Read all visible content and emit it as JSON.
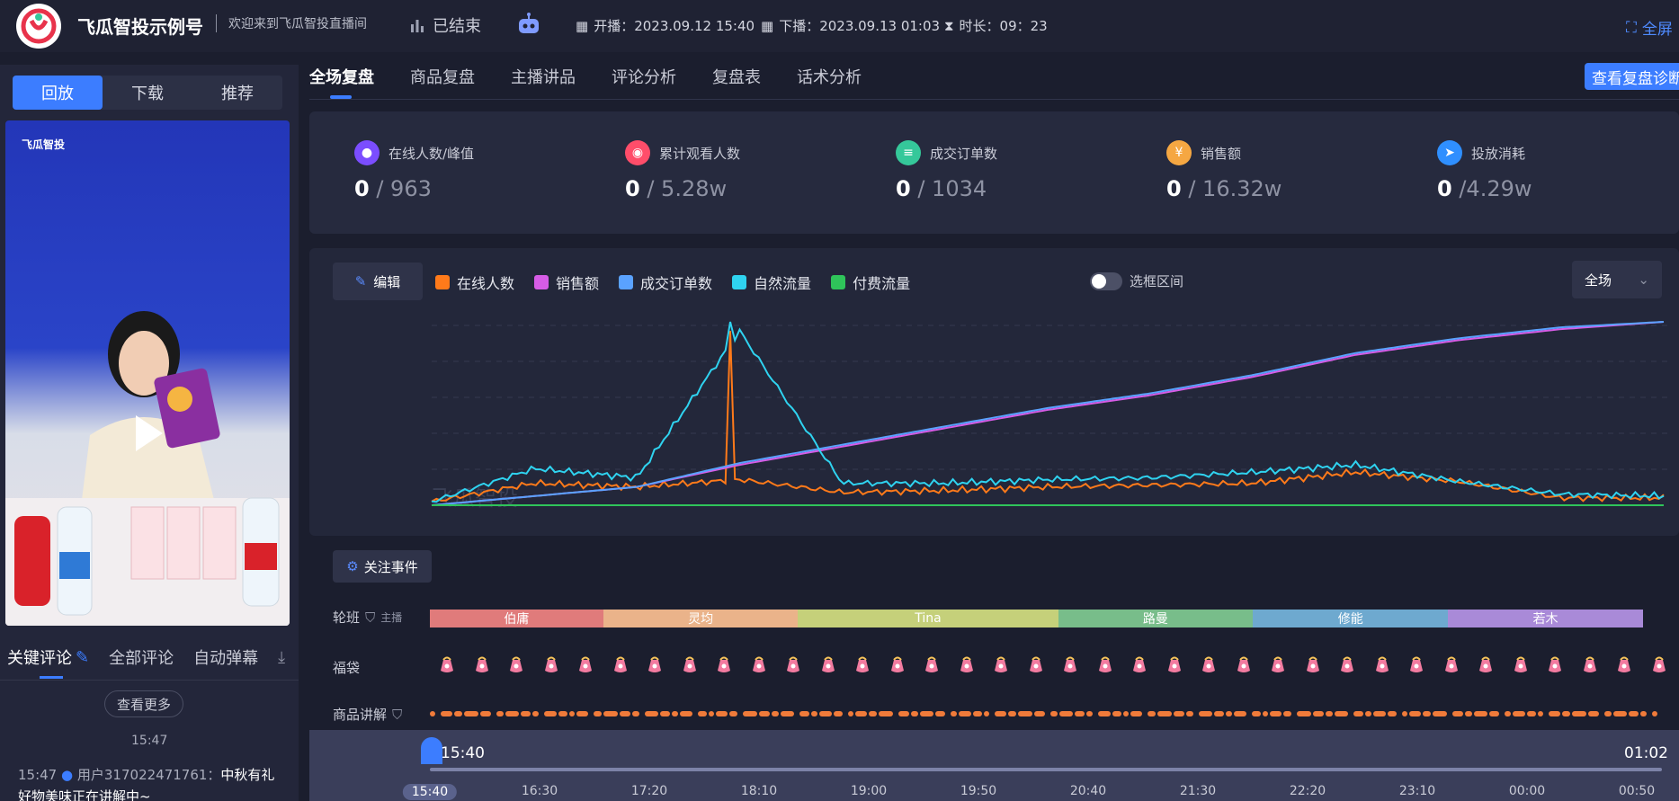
{
  "header": {
    "brand": "飞瓜智投示例号",
    "welcome": "欢迎来到飞瓜智投直播间",
    "status": "已结束",
    "start_label": "开播：2023.09.12 15:40",
    "end_label": "下播：2023.09.13 01:03",
    "duration_label": "时长：09：23",
    "fullscreen": "全屏"
  },
  "left": {
    "tabs": [
      "回放",
      "下载",
      "推荐"
    ],
    "video_logo": "飞瓜智投",
    "comment_tabs": [
      "关键评论",
      "全部评论",
      "自动弹幕"
    ],
    "more": "查看更多",
    "time": "15:47",
    "comment_time": "15:47",
    "comment_user": "用户317022471761：",
    "comment_text": "中秋有礼好物美味正在讲解中~"
  },
  "main_tabs": [
    "全场复盘",
    "商品复盘",
    "主播讲品",
    "评论分析",
    "复盘表",
    "话术分析"
  ],
  "diag_button": "查看复盘诊断",
  "stats": [
    {
      "label": "在线人数/峰值",
      "value": "0",
      "total": " / 963",
      "color": "#7b4dff",
      "icon": "user-icon"
    },
    {
      "label": "累计观看人数",
      "value": "0",
      "total": " / 5.28w",
      "color": "#ff4d6a",
      "icon": "eye-icon"
    },
    {
      "label": "成交订单数",
      "value": "0",
      "total": " / 1034",
      "color": "#35c89a",
      "icon": "order-icon"
    },
    {
      "label": "销售额",
      "value": "0",
      "total": " / 16.32w",
      "color": "#f5a742",
      "icon": "yen-icon"
    },
    {
      "label": "投放消耗",
      "value": "0",
      "total": " /4.29w",
      "color": "#2f8fff",
      "icon": "send-icon"
    }
  ],
  "chart_controls": {
    "edit": "编辑",
    "legend": [
      {
        "name": "在线人数",
        "color": "#ff7a1a"
      },
      {
        "name": "销售额",
        "color": "#d65ce6"
      },
      {
        "name": "成交订单数",
        "color": "#5aa2ff"
      },
      {
        "name": "自然流量",
        "color": "#2fd3f0"
      },
      {
        "name": "付费流量",
        "color": "#2fc45a"
      }
    ],
    "range_toggle": "选框区间",
    "scope": "全场"
  },
  "chart_data": {
    "type": "line",
    "x": [
      "15:40",
      "16:30",
      "17:20",
      "18:10",
      "19:00",
      "19:50",
      "20:40",
      "21:30",
      "22:20",
      "23:10",
      "00:00",
      "00:50",
      "01:02"
    ],
    "series": [
      {
        "name": "在线人数",
        "values": [
          0.02,
          0.12,
          0.1,
          0.14,
          0.07,
          0.08,
          0.1,
          0.11,
          0.12,
          0.18,
          0.13,
          0.04,
          0.04
        ]
      },
      {
        "name": "销售额",
        "values": [
          0.0,
          0.05,
          0.1,
          0.22,
          0.32,
          0.42,
          0.52,
          0.6,
          0.7,
          0.82,
          0.9,
          0.96,
          1.0
        ]
      },
      {
        "name": "成交订单数",
        "values": [
          0.0,
          0.05,
          0.1,
          0.23,
          0.33,
          0.43,
          0.53,
          0.61,
          0.71,
          0.83,
          0.91,
          0.97,
          1.0
        ]
      },
      {
        "name": "自然流量",
        "values": [
          0.02,
          0.2,
          0.15,
          0.95,
          0.12,
          0.12,
          0.14,
          0.15,
          0.18,
          0.22,
          0.13,
          0.06,
          0.05
        ]
      },
      {
        "name": "付费流量",
        "values": [
          0.0,
          0.0,
          0.0,
          0.0,
          0.0,
          0.0,
          0.0,
          0.0,
          0.0,
          0.0,
          0.0,
          0.0,
          0.0
        ]
      }
    ],
    "watermark": "飞瓜智投"
  },
  "events": {
    "focus_button": "关注事件",
    "shift_label": "轮班",
    "host_label": "主播",
    "shifts": [
      {
        "name": "伯庸",
        "frac": 0.12,
        "color": "#e07b7b"
      },
      {
        "name": "灵均",
        "frac": 0.135,
        "color": "#eab38a"
      },
      {
        "name": "Tina",
        "frac": 0.18,
        "color": "#c5d07a"
      },
      {
        "name": "路曼",
        "frac": 0.135,
        "color": "#78bd8a"
      },
      {
        "name": "修能",
        "frac": 0.135,
        "color": "#6ea9cf"
      },
      {
        "name": "若木",
        "frac": 0.135,
        "color": "#a98ad8"
      }
    ],
    "bag_label": "福袋",
    "product_label": "商品讲解"
  },
  "timeline": {
    "start": "15:40",
    "end": "01:02",
    "ticks": [
      "15:40",
      "16:30",
      "17:20",
      "18:10",
      "19:00",
      "19:50",
      "20:40",
      "21:30",
      "22:20",
      "23:10",
      "00:00",
      "00:50"
    ]
  }
}
